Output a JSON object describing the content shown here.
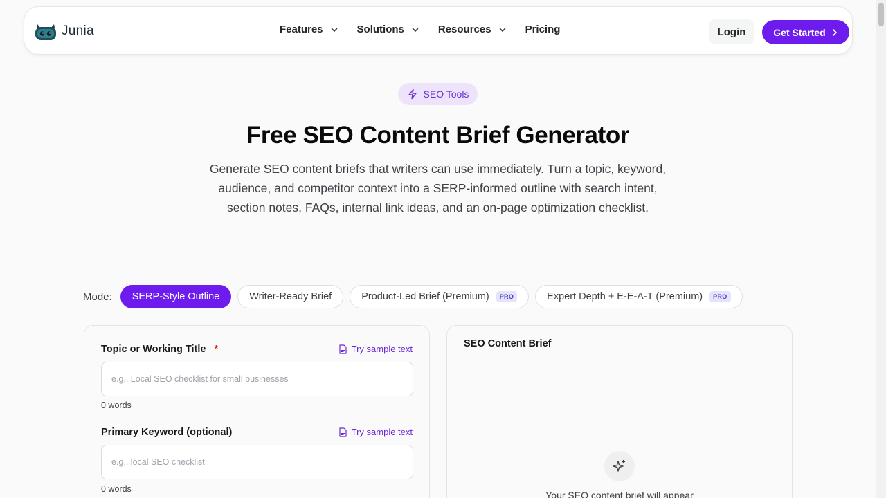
{
  "nav": {
    "logo_text": "Junia",
    "links": [
      {
        "label": "Features",
        "has_dropdown": true
      },
      {
        "label": "Solutions",
        "has_dropdown": true
      },
      {
        "label": "Resources",
        "has_dropdown": true
      },
      {
        "label": "Pricing",
        "has_dropdown": false
      }
    ],
    "login_label": "Login",
    "get_started_label": "Get Started"
  },
  "hero": {
    "badge": "SEO Tools",
    "title": "Free SEO Content Brief Generator",
    "description": "Generate SEO content briefs that writers can use immediately. Turn a topic, keyword, audience, and competitor context into a SERP-informed outline with search intent, section notes, FAQs, internal link ideas, and an on-page optimization checklist."
  },
  "mode": {
    "label": "Mode:",
    "options": [
      {
        "label": "SERP-Style Outline",
        "active": true,
        "pro": false
      },
      {
        "label": "Writer-Ready Brief",
        "active": false,
        "pro": false
      },
      {
        "label": "Product-Led Brief (Premium)",
        "active": false,
        "pro": true
      },
      {
        "label": "Expert Depth + E-E-A-T (Premium)",
        "active": false,
        "pro": true
      }
    ],
    "pro_label": "PRO"
  },
  "form": {
    "topic": {
      "label": "Topic or Working Title",
      "required_mark": "*",
      "sample_label": "Try sample text",
      "placeholder": "e.g., Local SEO checklist for small businesses",
      "value": "",
      "word_count": "0 words"
    },
    "keyword": {
      "label": "Primary Keyword (optional)",
      "sample_label": "Try sample text",
      "placeholder": "e.g., local SEO checklist",
      "value": "",
      "word_count": "0 words"
    }
  },
  "output": {
    "title": "SEO Content Brief",
    "empty_text": "Your SEO content brief will appear"
  },
  "colors": {
    "accent": "#6d1ced",
    "badge_bg": "#ede4fc",
    "required": "#dc2626"
  }
}
